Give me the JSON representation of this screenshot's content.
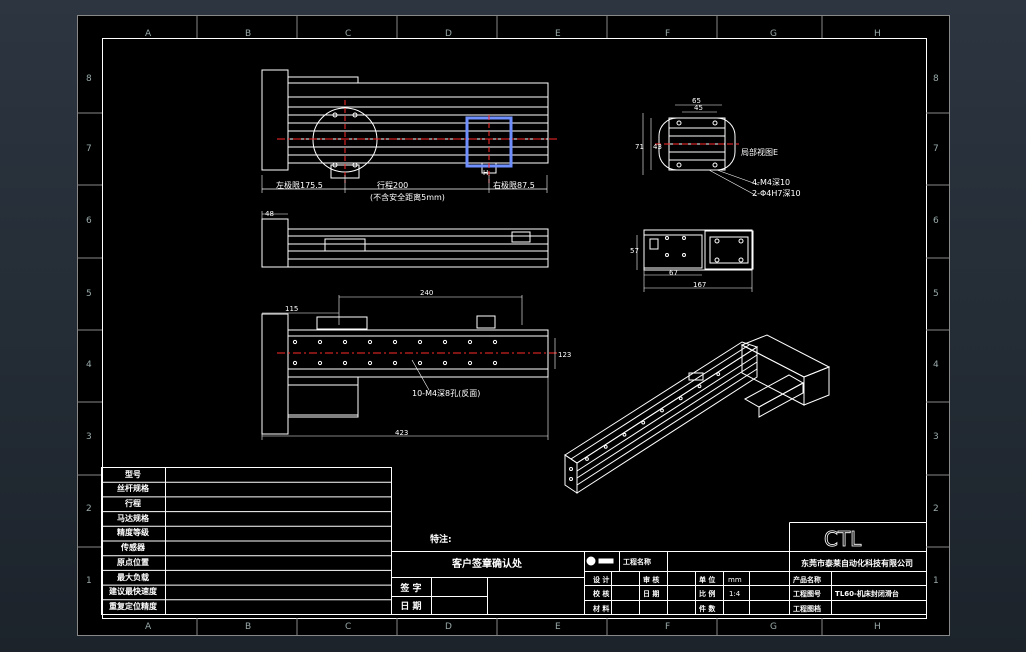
{
  "colors": {
    "background": "#212830",
    "sheet": "#000000",
    "line": "#ffffff",
    "centerline": "#ff2a2a",
    "highlight": "#6f8fff"
  },
  "border": {
    "columns": [
      "A",
      "B",
      "C",
      "D",
      "E",
      "F",
      "G",
      "H"
    ],
    "rows": [
      "8",
      "7",
      "6",
      "5",
      "4",
      "3",
      "2",
      "1"
    ]
  },
  "view_top": {
    "left_limit": "左极限175.5",
    "stroke": "行程200",
    "stroke_note": "(不含安全距离5mm)",
    "right_limit": "右极限87.5",
    "limit_mark": "H"
  },
  "view_bottom": {
    "hole_note": "10-M4深8孔(反面)",
    "dim_total": "423",
    "dim_left": "115",
    "dim_span": "240",
    "dim_height": "123"
  },
  "view_end": {
    "note_detail": "局部视图E",
    "note_m4": "4-M4深10",
    "note_phi": "2-Φ4H7深10",
    "dim_a": "65",
    "dim_b": "45",
    "dim_c": "43",
    "dim_d": "71"
  },
  "view_side": {
    "dim_w": "167",
    "dim_h": "57",
    "dim_i": "67"
  },
  "view_mid": {
    "dim_offset": "48"
  },
  "spec_table": {
    "rows": [
      "型号",
      "丝杆规格",
      "行程",
      "马达规格",
      "精度等级",
      "传感器",
      "原点位置",
      "最大负载",
      "建议最快速度",
      "重复定位精度"
    ]
  },
  "remarks": {
    "label": "特注:"
  },
  "customer": {
    "title": "客户签章确认处",
    "sign": "签 字",
    "date": "日 期"
  },
  "title_block": {
    "logo": "CTL",
    "company": "东莞市泰莱自动化科技有限公司",
    "drawing_name": "工程名称",
    "product_label": "产品名称",
    "product_name": "TL60-机床封闭滑台",
    "design": "设 计",
    "check": "校 核",
    "material": "材 料",
    "review": "审 核",
    "date": "日 期",
    "count": "件 数",
    "unit": "单 位",
    "unit_value": "mm",
    "scale": "比 例",
    "scale_value": "1:4",
    "drawing_no": "工程图号",
    "archive": "工程图档"
  }
}
